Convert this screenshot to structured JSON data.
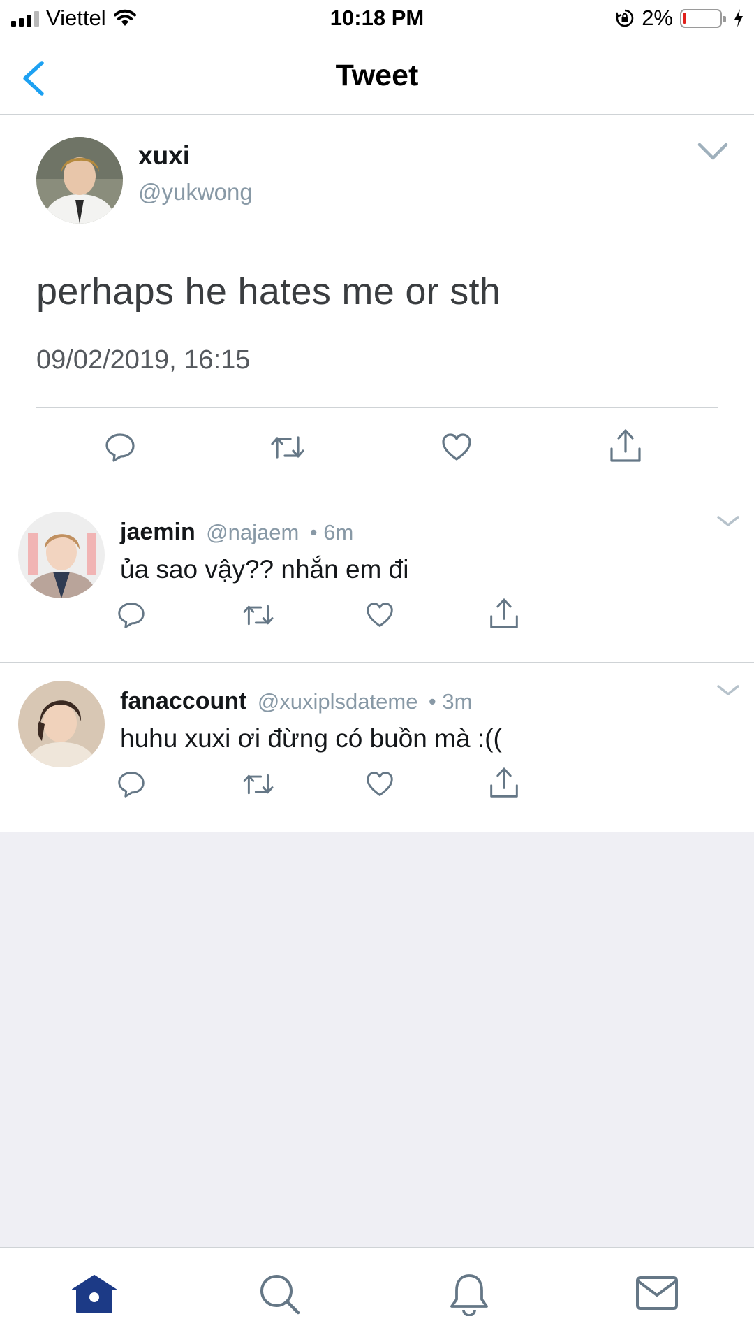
{
  "status_bar": {
    "carrier": "Viettel",
    "time": "10:18 PM",
    "battery_percent": "2%"
  },
  "nav": {
    "title": "Tweet"
  },
  "tweet": {
    "name": "xuxi",
    "handle": "@yukwong",
    "text": "perhaps he hates me or sth",
    "timestamp": "09/02/2019, 16:15"
  },
  "replies": [
    {
      "name": "jaemin",
      "handle": "@najaem",
      "age": "• 6m",
      "text": "ủa sao vậy?? nhắn em đi"
    },
    {
      "name": "fanaccount",
      "handle": "@xuxiplsdateme",
      "age": "• 3m",
      "text": "huhu xuxi ơi đừng có buồn mà :(("
    }
  ],
  "icons": {
    "back": "chevron-left-icon",
    "caret": "chevron-down-icon",
    "reply": "reply-icon",
    "retweet": "retweet-icon",
    "like": "heart-icon",
    "share": "share-icon",
    "home": "home-icon",
    "search": "search-icon",
    "notifications": "bell-icon",
    "messages": "mail-icon"
  },
  "colors": {
    "accent": "#1da1f2",
    "active_tab": "#1c3a86",
    "icon": "#657786",
    "secondary_text": "#8899a6",
    "background": "#efeff4"
  }
}
